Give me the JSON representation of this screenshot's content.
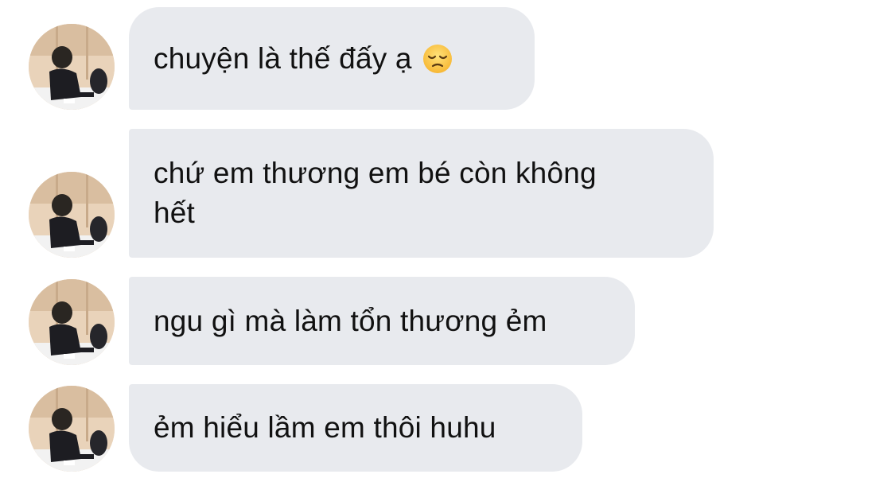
{
  "contact": {
    "avatar_icon": "user-avatar-icon"
  },
  "colors": {
    "bubble_background": "#e8eaee",
    "text": "#111111",
    "background": "#ffffff"
  },
  "messages": [
    {
      "text": "chuyện là thế đấy ạ",
      "emoji": "disappointed-face-icon"
    },
    {
      "text": "chứ em thương em bé còn không\nhết"
    },
    {
      "text": "ngu gì mà làm tổn thương ẻm"
    },
    {
      "text": "ẻm hiểu lầm em thôi huhu"
    }
  ]
}
